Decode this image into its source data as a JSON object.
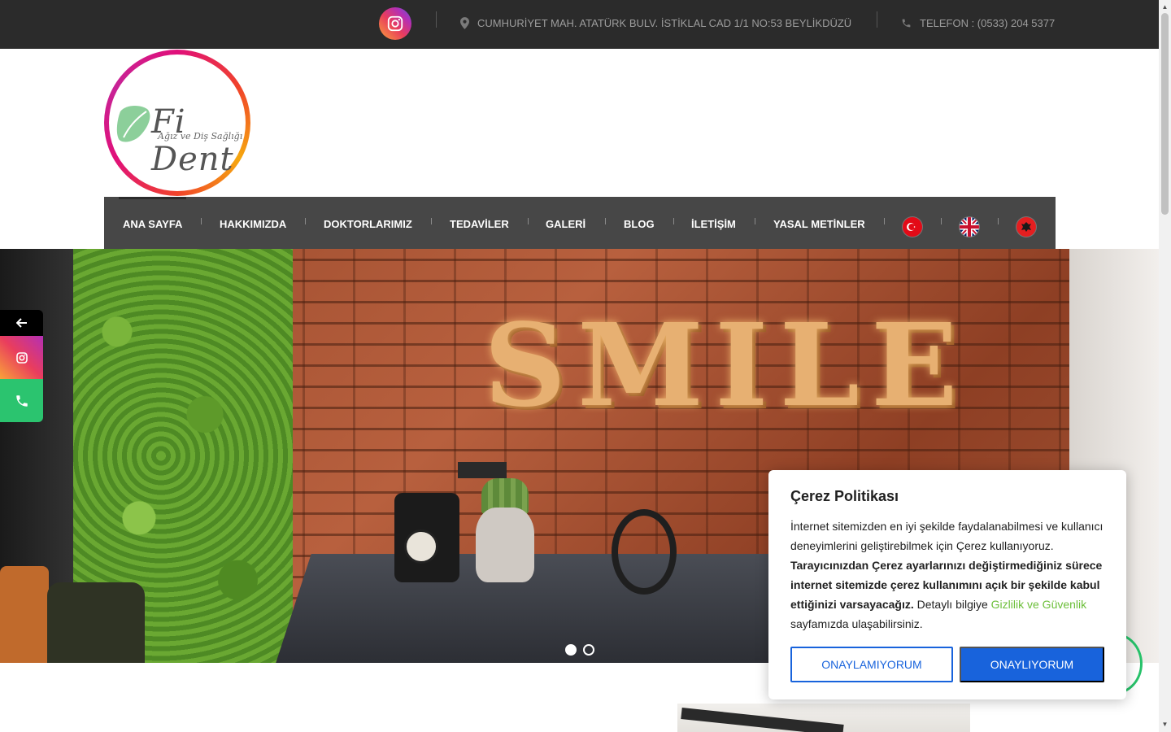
{
  "topbar": {
    "address": "CUMHURİYET MAH. ATATÜRK BULV. İSTİKLAL CAD 1/1 NO:53 BEYLİKDÜZÜ",
    "phone": "TELEFON : (0533) 204 5377",
    "icons": [
      "instagram-icon",
      "map-marker-icon",
      "phone-icon"
    ]
  },
  "logo": {
    "name": "Fi Dent",
    "subtitle": "Ağız ve Diş Sağlığı"
  },
  "nav": {
    "items": [
      {
        "label": "ANA SAYFA"
      },
      {
        "label": "HAKKIMIZDA"
      },
      {
        "label": "DOKTORLARIMIZ"
      },
      {
        "label": "TEDAVİLER"
      },
      {
        "label": "GALERİ"
      },
      {
        "label": "BLOG"
      },
      {
        "label": "İLETİŞİM"
      },
      {
        "label": "YASAL METİNLER"
      }
    ],
    "flags": [
      "turkey-flag-icon",
      "uk-flag-icon",
      "albania-flag-icon"
    ]
  },
  "hero": {
    "sign_text": "SMILE",
    "slides_total": 2,
    "active_slide": 1
  },
  "side_social": {
    "icons": [
      "arrow-left-icon",
      "instagram-icon",
      "phone-icon"
    ]
  },
  "cookie": {
    "title": "Çerez Politikası",
    "text_1": "İnternet sitemizden en iyi şekilde faydalanabilmesi ve kullanıcı deneyimlerini geliştirebilmek için Çerez kullanıyoruz.",
    "text_bold": "Tarayıcınızdan Çerez ayarlarınızı değiştirmediğiniz sürece internet sitemizde çerez kullanımını açık bir şekilde kabul ettiğinizi varsayacağız.",
    "text_2": "Detaylı bilgiye",
    "link": "Gizlilik ve Güvenlik",
    "text_3": "sayfamızda ulaşabilirsiniz.",
    "reject": "ONAYLAMIYORUM",
    "accept": "ONAYLIYORUM"
  },
  "colors": {
    "topbar": "#2b2b2b",
    "navbar": "#474747",
    "accent_blue": "#1863dc",
    "link_green": "#6cbf3a"
  }
}
